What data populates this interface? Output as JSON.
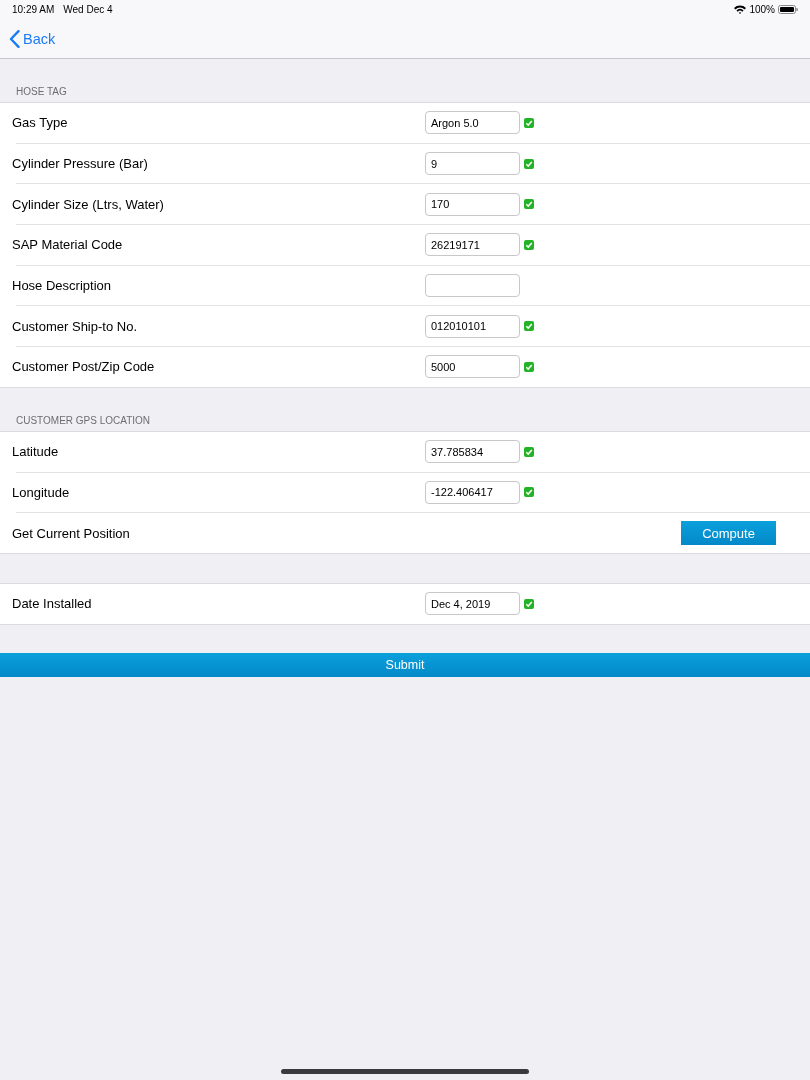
{
  "status_bar": {
    "time": "10:29 AM",
    "date": "Wed Dec 4",
    "battery": "100%"
  },
  "nav_bar": {
    "back": "Back"
  },
  "sections": [
    {
      "header": "HOSE TAG",
      "rows": [
        {
          "kind": "field",
          "label": "Gas Type",
          "value": "Argon 5.0",
          "valid": true
        },
        {
          "kind": "field",
          "label": "Cylinder Pressure (Bar)",
          "value": "9",
          "valid": true
        },
        {
          "kind": "field",
          "label": "Cylinder Size (Ltrs, Water)",
          "value": "170",
          "valid": true
        },
        {
          "kind": "field",
          "label": "SAP Material Code",
          "value": "26219171",
          "valid": true
        },
        {
          "kind": "field",
          "label": "Hose Description",
          "valid": false
        },
        {
          "kind": "field",
          "label": "Customer Ship-to No.",
          "value": "012010101",
          "valid": true
        },
        {
          "kind": "field",
          "label": "Customer Post/Zip Code",
          "value": "5000",
          "valid": true
        }
      ]
    },
    {
      "header": "CUSTOMER GPS LOCATION",
      "rows": [
        {
          "kind": "field",
          "label": "Latitude",
          "value": "37.785834",
          "valid": true
        },
        {
          "kind": "field",
          "label": "Longitude",
          "value": "-122.406417",
          "valid": true
        },
        {
          "kind": "action",
          "label": "Get Current Position",
          "button": "Compute"
        }
      ]
    },
    {
      "rows": [
        {
          "kind": "field",
          "label": "Date Installed",
          "value": "Dec 4, 2019",
          "valid": true
        }
      ]
    }
  ],
  "submit": "Submit"
}
